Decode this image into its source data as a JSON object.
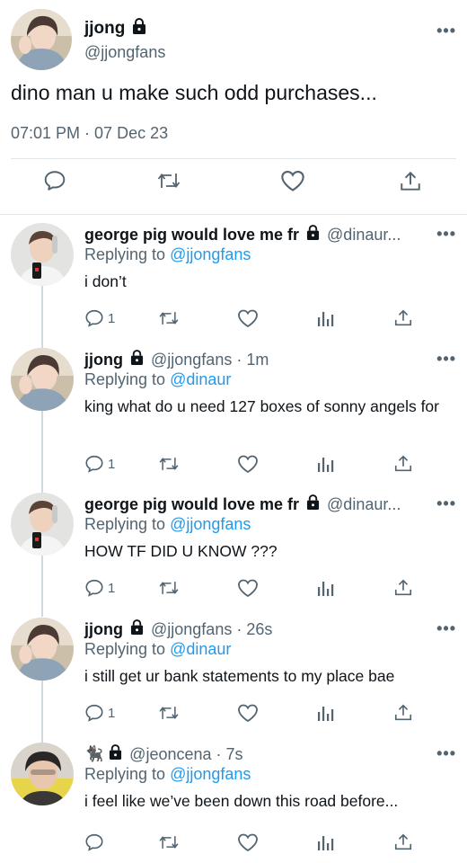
{
  "main_tweet": {
    "author_name": "jjong",
    "handle": "@jjongfans",
    "text": "dino man u make such odd purchases...",
    "timestamp": "07:01 PM · 07 Dec 23",
    "more_label": "•••",
    "avatar": "avatar-jjong"
  },
  "replies": [
    {
      "name": "george pig would love me fr",
      "handle": "@dinaur...",
      "replying_prefix": "Replying to",
      "replying_to": "@jjongfans",
      "text": "i don’t",
      "reply_count": "1",
      "avatar": "avatar-george"
    },
    {
      "name": "jjong",
      "handle": "@jjongfans · 1m",
      "replying_prefix": "Replying to",
      "replying_to": "@dinaur",
      "text": "king what do u need 127 boxes of sonny angels for",
      "reply_count": "1",
      "avatar": "avatar-jjong"
    },
    {
      "name": "george pig would love me fr",
      "handle": "@dinaur...",
      "replying_prefix": "Replying to",
      "replying_to": "@jjongfans",
      "text": "HOW TF DID U KNOW ???",
      "reply_count": "1",
      "avatar": "avatar-george"
    },
    {
      "name": "jjong",
      "handle": "@jjongfans · 26s",
      "replying_prefix": "Replying to",
      "replying_to": "@dinaur",
      "text": "i still get ur bank statements to my place bae",
      "reply_count": "1",
      "avatar": "avatar-jjong"
    },
    {
      "name": "🐈‍⬛",
      "handle": "@jeoncena · 7s",
      "replying_prefix": "Replying to",
      "replying_to": "@jjongfans",
      "text": "i feel like we’ve been down this road before...",
      "reply_count": "",
      "avatar": "avatar-jeoncena"
    }
  ],
  "icons": {
    "reply": "reply-icon",
    "retweet": "retweet-icon",
    "like": "heart-icon",
    "views": "views-icon",
    "share": "share-icon",
    "lock": "lock-icon"
  },
  "colors": {
    "link": "#1d9bf0",
    "secondary": "#536471",
    "divider": "#e1e6ea"
  }
}
